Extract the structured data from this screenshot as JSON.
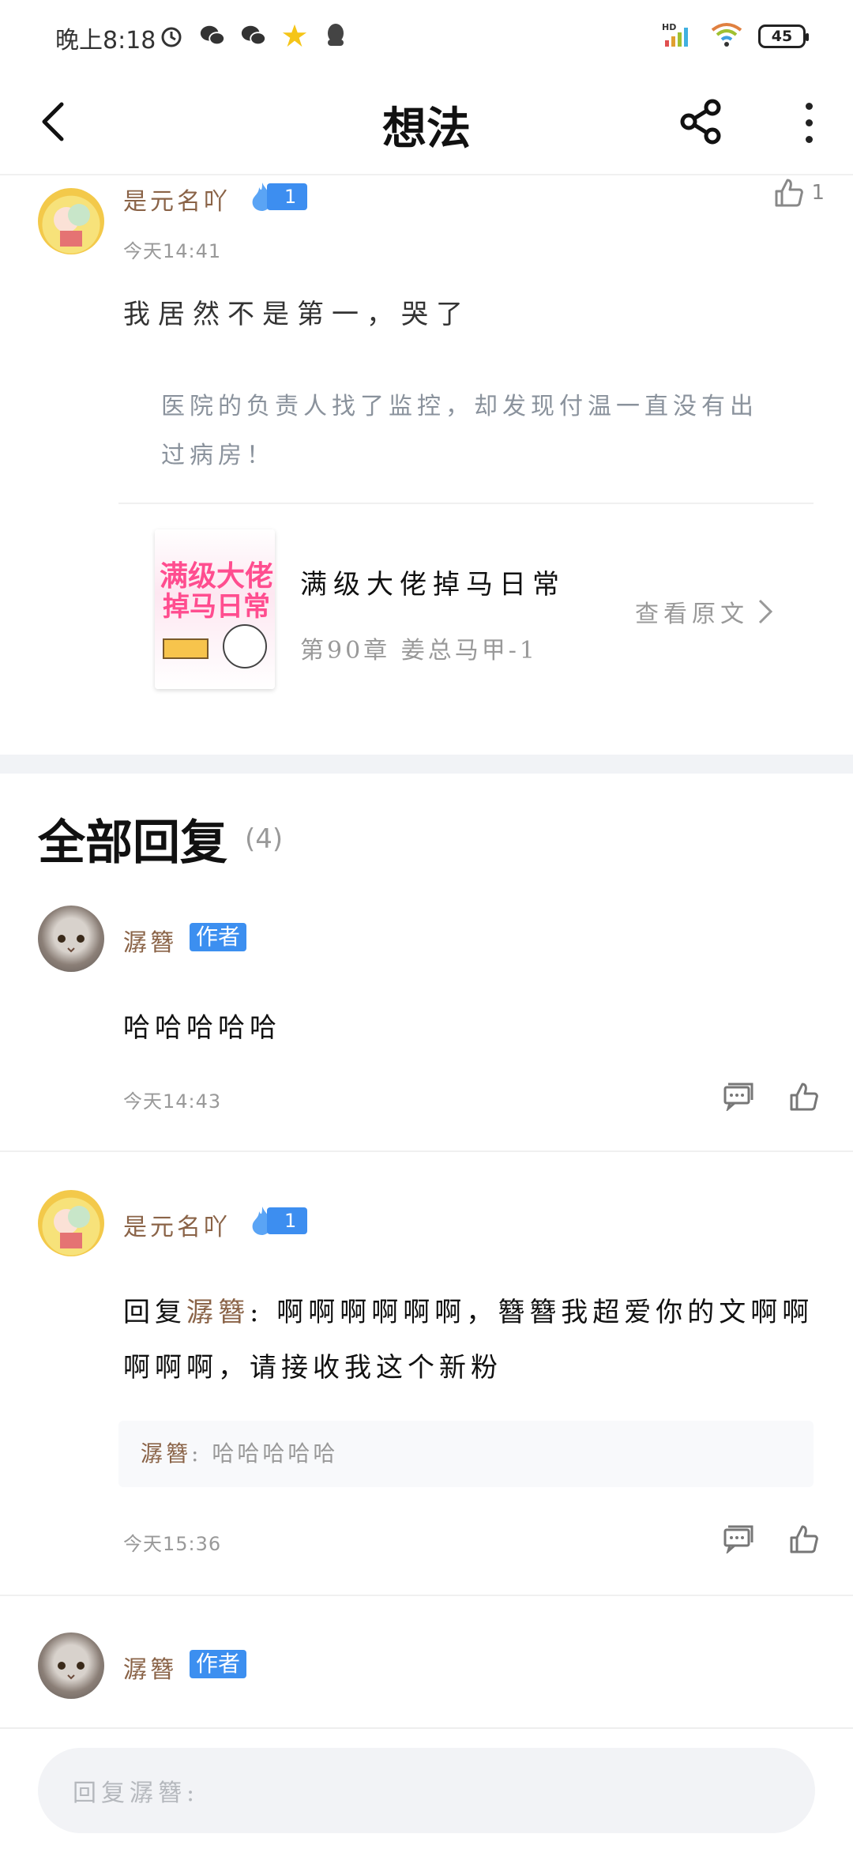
{
  "status_bar": {
    "time": "晚上8:18",
    "battery": "45",
    "network": "HD"
  },
  "header": {
    "title": "想法"
  },
  "post": {
    "username": "是元名吖",
    "fire_badge": "1",
    "time": "今天14:41",
    "likes": "1",
    "text": "我居然不是第一，哭了",
    "quote": "医院的负责人找了监控，却发现付温一直没有出过病房！",
    "book": {
      "cover_title_line1": "满级大佬",
      "cover_title_line2": "掉马日常",
      "name": "满级大佬掉马日常",
      "chapter": "第90章 姜总马甲-1",
      "view_original": "查看原文"
    }
  },
  "replies": {
    "title": "全部回复",
    "count": "(4)",
    "items": [
      {
        "username": "潺簪",
        "badge": "作者",
        "text": "哈哈哈哈哈",
        "time": "今天14:43"
      },
      {
        "username": "是元名吖",
        "fire_badge": "1",
        "reply_prefix": "回复",
        "mention": "潺簪",
        "text": ": 啊啊啊啊啊啊，簪簪我超爱你的文啊啊啊啊啊，请接收我这个新粉",
        "quote_name": "潺簪",
        "quote_text": ": 哈哈哈哈哈",
        "time": "今天15:36"
      },
      {
        "username": "潺簪",
        "badge": "作者"
      }
    ]
  },
  "bottom": {
    "input_placeholder": "回复潺簪:"
  },
  "colors": {
    "accent_blue": "#3c8ff0",
    "username_brown": "#8a6347"
  }
}
